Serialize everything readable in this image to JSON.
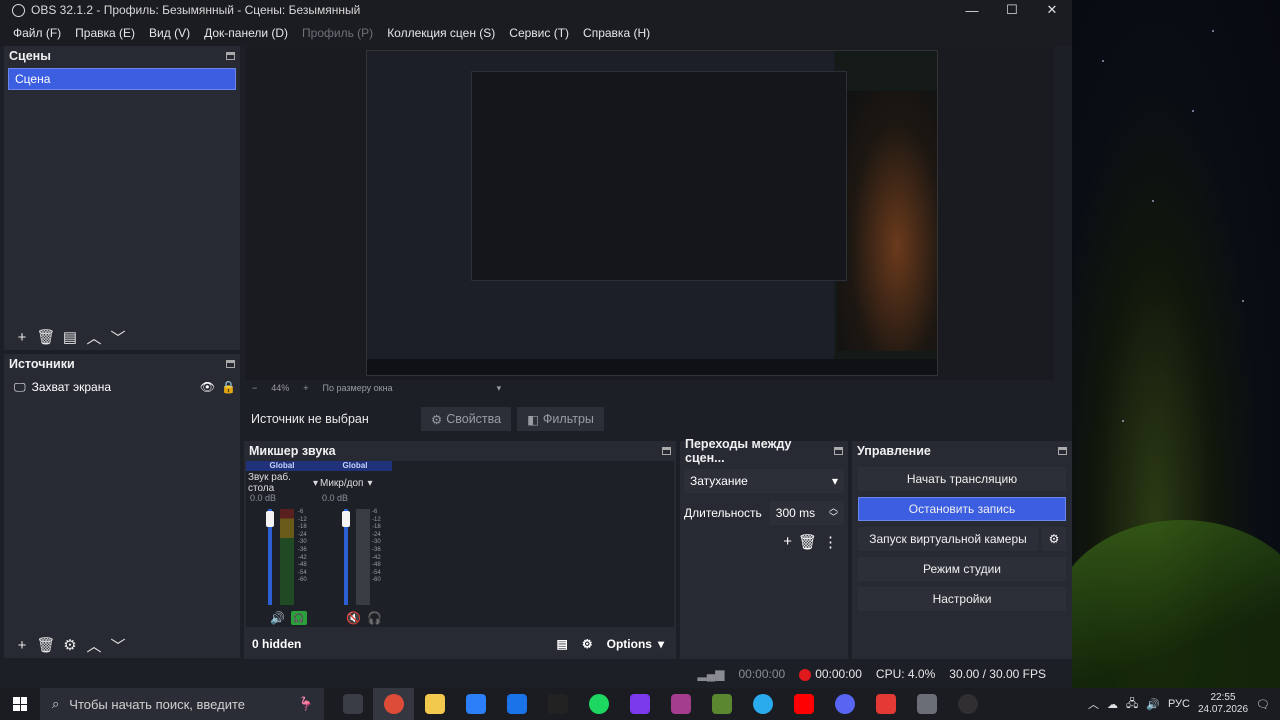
{
  "window": {
    "title": "OBS 32.1.2 - Профиль: Безымянный - Сцены: Безымянный",
    "controls": {
      "minimize": "—",
      "maximize": "☐",
      "close": "✕"
    }
  },
  "menu": [
    "Файл (F)",
    "Правка (E)",
    "Вид (V)",
    "Док-панели (D)",
    "Профиль (P)",
    "Коллекция сцен (S)",
    "Сервис (T)",
    "Справка (H)"
  ],
  "scenes": {
    "title": "Сцены",
    "items": [
      "Сцена"
    ]
  },
  "sources": {
    "title": "Источники",
    "items": [
      "Захват экрана"
    ]
  },
  "preview": {
    "zoom": "44%",
    "fit_label": "По размеру окна"
  },
  "context": {
    "no_source": "Источник не выбран",
    "properties": "Свойства",
    "filters": "Фильтры"
  },
  "mixer": {
    "title": "Микшер звука",
    "channels": [
      {
        "tag": "Global",
        "name": "Звук раб. стола",
        "db": "0.0 dB"
      },
      {
        "tag": "Global",
        "name": "Микр/доп",
        "db": "0.0 dB"
      }
    ],
    "ticks": [
      "-6",
      "-12",
      "-18",
      "-24",
      "-30",
      "-36",
      "-42",
      "-48",
      "-54",
      "-60"
    ],
    "hidden": "0 hidden",
    "options": "Options"
  },
  "transitions": {
    "title": "Переходы между сцен...",
    "type": "Затухание",
    "duration_label": "Длительность",
    "duration": "300 ms"
  },
  "controls": {
    "title": "Управление",
    "start_stream": "Начать трансляцию",
    "stop_record": "Остановить запись",
    "virtual_cam": "Запуск виртуальной камеры",
    "studio_mode": "Режим студии",
    "settings": "Настройки"
  },
  "status": {
    "stream_time": "00:00:00",
    "rec_time": "00:00:00",
    "cpu": "CPU: 4.0%",
    "fps": "30.00 / 30.00 FPS"
  },
  "taskbar": {
    "search_placeholder": "Чтобы начать поиск, введите",
    "language": "РУС",
    "time": "22:55",
    "date": "24.07.2026",
    "apps": [
      {
        "name": "task-view",
        "color": "#3a3d45"
      },
      {
        "name": "chrome",
        "color": "#dd4b39"
      },
      {
        "name": "file-explorer",
        "color": "#f2c94c"
      },
      {
        "name": "store",
        "color": "#2d7ff9"
      },
      {
        "name": "outlook",
        "color": "#1a73e8"
      },
      {
        "name": "hex-editor",
        "color": "#222222"
      },
      {
        "name": "spotify",
        "color": "#1ed760"
      },
      {
        "name": "obsidian",
        "color": "#7c3aed"
      },
      {
        "name": "winrar",
        "color": "#a33d8c"
      },
      {
        "name": "minecraft",
        "color": "#5b8731"
      },
      {
        "name": "telegram",
        "color": "#2aabee"
      },
      {
        "name": "youtube",
        "color": "#ff0000"
      },
      {
        "name": "discord",
        "color": "#5865f2"
      },
      {
        "name": "wps",
        "color": "#e53935"
      },
      {
        "name": "settings",
        "color": "#6b6e76"
      },
      {
        "name": "obs",
        "color": "#302e31"
      }
    ]
  },
  "colors": {
    "accent": "#3c5ee0",
    "panel": "#272a33",
    "background": "#1d1f26",
    "rec": "#e0191c"
  }
}
